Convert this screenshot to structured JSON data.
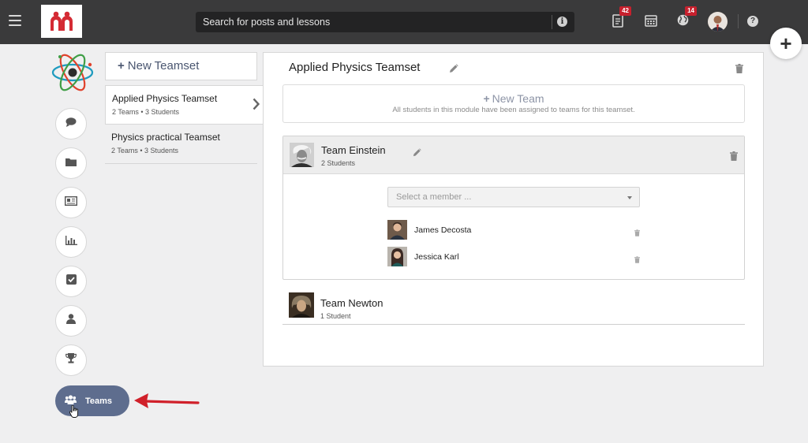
{
  "topbar": {
    "search_placeholder": "Search for posts and lessons",
    "notifications_badge": "42",
    "globe_badge": "14",
    "icons": [
      "menu-icon",
      "info-icon",
      "document-icon",
      "calendar-icon",
      "globe-icon",
      "help-icon",
      "plus-icon"
    ]
  },
  "sidebar": {
    "items": [
      {
        "icon": "chat-icon"
      },
      {
        "icon": "folder-icon"
      },
      {
        "icon": "news-icon"
      },
      {
        "icon": "chart-icon"
      },
      {
        "icon": "checkbox-icon"
      },
      {
        "icon": "user-icon"
      },
      {
        "icon": "trophy-icon"
      }
    ],
    "active_label": "Teams"
  },
  "teamsets": {
    "new_label": "New Teamset",
    "items": [
      {
        "title": "Applied Physics Teamset",
        "subtitle": "2 Teams • 3 Students"
      },
      {
        "title": "Physics practical Teamset",
        "subtitle": "2 Teams • 3 Students"
      }
    ]
  },
  "main": {
    "title": "Applied Physics Teamset",
    "new_team_label": "New Team",
    "new_team_note": "All students in this module have been assigned to teams for this teamset.",
    "teams": [
      {
        "name": "Team Einstein",
        "count": "2 Students",
        "select_placeholder": "Select a member ...",
        "members": [
          "James Decosta",
          "Jessica Karl"
        ]
      },
      {
        "name": "Team Newton",
        "count": "1 Student"
      }
    ]
  },
  "colors": {
    "topbar": "#3a3a3b",
    "accent_pill": "#5e6d8e",
    "badge": "#c7202d",
    "arrow": "#d0202a"
  }
}
